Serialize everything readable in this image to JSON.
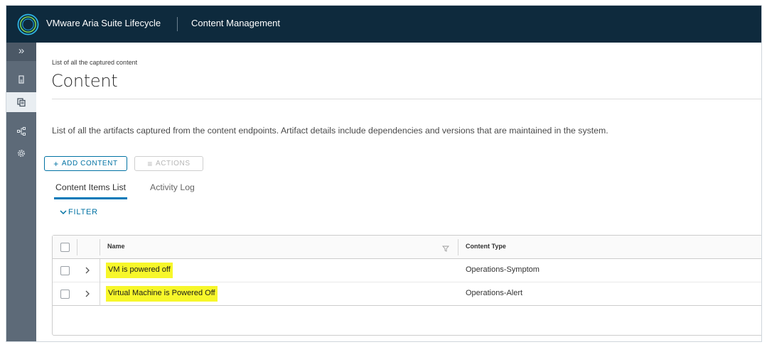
{
  "header": {
    "app_title": "VMware Aria Suite Lifecycle",
    "section_title": "Content Management"
  },
  "sidebar": {
    "collapse_glyph": "»",
    "items": [
      {
        "icon": "datacenter-icon",
        "active": false
      },
      {
        "icon": "content-copy-icon",
        "active": true
      },
      {
        "icon": "pipeline-icon",
        "active": false
      },
      {
        "icon": "gear-icon",
        "active": false
      }
    ]
  },
  "page": {
    "subtitle": "List of all the captured content",
    "title": "Content",
    "description": "List of all the artifacts captured from the content endpoints. Artifact details include dependencies and versions that are maintained in the system."
  },
  "toolbar": {
    "add_icon": "+",
    "add_label": "ADD CONTENT",
    "actions_icon": "≡",
    "actions_label": "ACTIONS"
  },
  "tabs": [
    {
      "label": "Content Items List",
      "active": true
    },
    {
      "label": "Activity Log",
      "active": false
    }
  ],
  "filter": {
    "label": "FILTER"
  },
  "table": {
    "columns": {
      "name": "Name",
      "content_type": "Content Type"
    },
    "rows": [
      {
        "name": "VM is powered off",
        "content_type": "Operations-Symptom"
      },
      {
        "name": "Virtual Machine is Powered Off",
        "content_type": "Operations-Alert"
      }
    ]
  },
  "colors": {
    "header_bg": "#0e2a3d",
    "sidebar_bg": "#5d6a78",
    "accent": "#0072a3",
    "highlight": "#f7f72a"
  }
}
